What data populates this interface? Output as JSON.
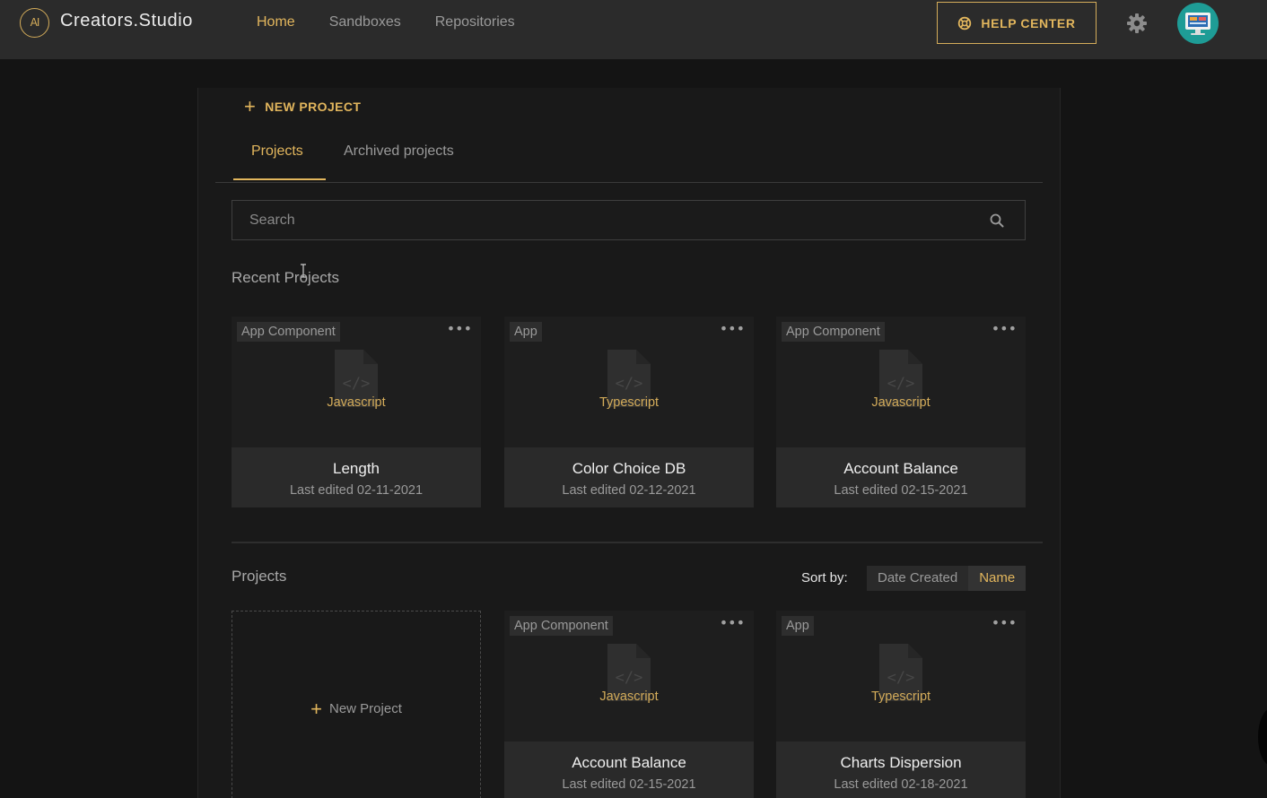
{
  "header": {
    "logo_text": "AI",
    "brand": "Creators.Studio",
    "nav": [
      {
        "label": "Home",
        "active": true
      },
      {
        "label": "Sandboxes",
        "active": false
      },
      {
        "label": "Repositories",
        "active": false
      }
    ],
    "help_label": "HELP CENTER",
    "accent": "#e2b65d"
  },
  "toolbar": {
    "new_project_label": "NEW PROJECT"
  },
  "tabs": [
    {
      "label": "Projects",
      "active": true
    },
    {
      "label": "Archived projects",
      "active": false
    }
  ],
  "search": {
    "placeholder": "Search",
    "value": ""
  },
  "recent": {
    "title": "Recent Projects",
    "cards": [
      {
        "type": "App Component",
        "lang": "Javascript",
        "name": "Length",
        "edited": "Last edited 02-11-2021"
      },
      {
        "type": "App",
        "lang": "Typescript",
        "name": "Color Choice DB",
        "edited": "Last edited 02-12-2021"
      },
      {
        "type": "App Component",
        "lang": "Javascript",
        "name": "Account Balance",
        "edited": "Last edited 02-15-2021"
      }
    ]
  },
  "projects": {
    "title": "Projects",
    "sort_label": "Sort by:",
    "sort_options": [
      {
        "label": "Date Created",
        "active": false
      },
      {
        "label": "Name",
        "active": true
      }
    ],
    "new_card_label": "New Project",
    "cards": [
      {
        "type": "App Component",
        "lang": "Javascript",
        "name": "Account Balance",
        "edited": "Last edited 02-15-2021"
      },
      {
        "type": "App",
        "lang": "Typescript",
        "name": "Charts Dispersion",
        "edited": "Last edited 02-18-2021"
      }
    ]
  },
  "icons": {
    "menu": "more-horizontal-icon",
    "file": "code-file-icon",
    "search": "search-icon",
    "settings": "gear-icon",
    "help": "lifebuoy-icon"
  }
}
